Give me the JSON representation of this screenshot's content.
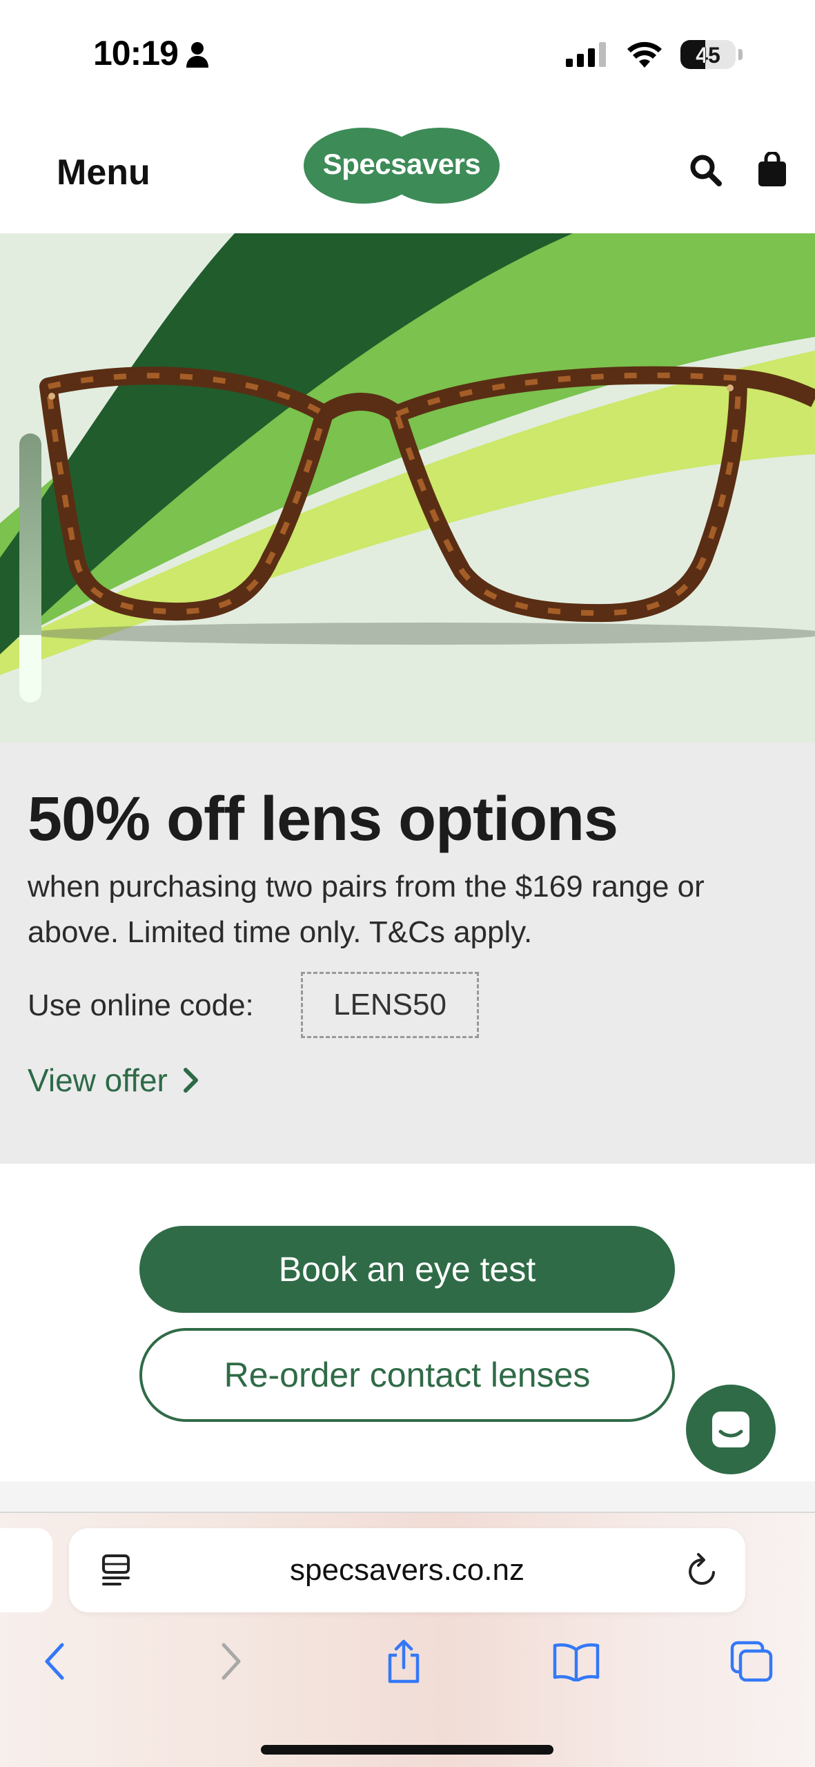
{
  "status_bar": {
    "time": "10:19",
    "battery": "45",
    "battery_level": 0.45
  },
  "header": {
    "menu_label": "Menu",
    "logo_text": "Specsavers",
    "brand_green": "#3d8b57"
  },
  "promo": {
    "title": "50% off lens options",
    "description": "when purchasing two pairs from the $169 range or above. Limited time only. T&Cs apply.",
    "code_label": "Use online code:",
    "code": "LENS50",
    "view_offer": "View offer"
  },
  "actions": {
    "book_label": "Book an eye test",
    "reorder_label": "Re-order contact lenses",
    "primary_color": "#2f6b47"
  },
  "browser": {
    "url": "specsavers.co.nz",
    "icons": [
      "reader-icon",
      "reload-icon",
      "back-icon",
      "forward-icon",
      "share-icon",
      "bookmarks-icon",
      "tabs-icon"
    ]
  }
}
